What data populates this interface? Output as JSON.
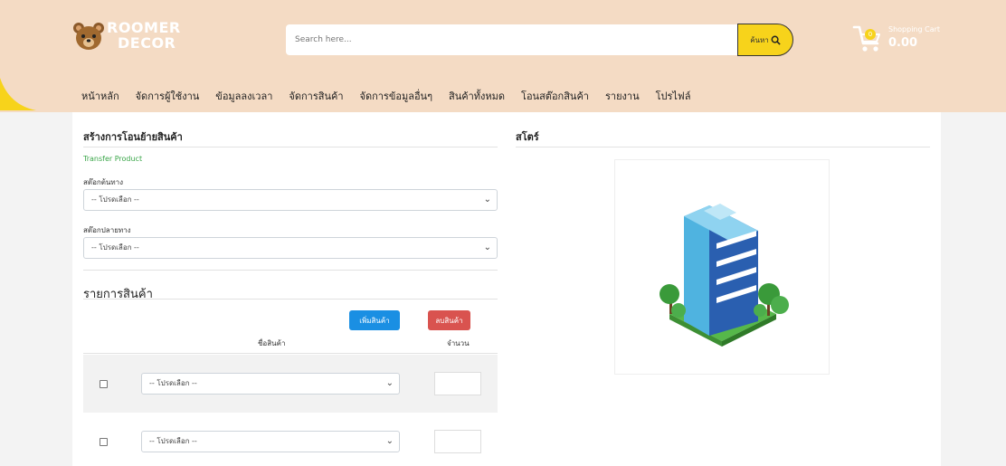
{
  "header": {
    "logo_line1": "ROOMER",
    "logo_line2": "DECOR",
    "search_placeholder": "Search here...",
    "search_button": "ค้นหา",
    "cart_count": "0",
    "cart_label": "Shopping Cart",
    "cart_total": "0.00"
  },
  "nav": [
    "หน้าหลัก",
    "จัดการผู้ใช้งาน",
    "ข้อมูลลงเวลา",
    "จัดการสินค้า",
    "จัดการข้อมูลอื่นๆ",
    "สินค้าทั้งหมด",
    "โอนสต๊อกสินค้า",
    "รายงาน",
    "โปรไฟล์"
  ],
  "form": {
    "title": "สร้างการโอนย้ายสินค้า",
    "subtitle": "Transfer Product",
    "source_label": "สต๊อกต้นทาง",
    "dest_label": "สต๊อกปลายทาง",
    "select_placeholder": "-- โปรดเลือก --"
  },
  "products": {
    "title": "รายการสินค้า",
    "add_button": "เพิ่มสินค้า",
    "delete_button": "ลบสินค้า",
    "col_name": "ชื่อสินค้า",
    "col_qty": "จำนวน",
    "rows": [
      {
        "select": "-- โปรดเลือก --"
      },
      {
        "select": "-- โปรดเลือก --"
      }
    ]
  },
  "store": {
    "title": "สโตร์"
  },
  "colors": {
    "header_bg": "#f4dbc4",
    "accent_yellow": "#f7d31b",
    "add_blue": "#1a8fe3",
    "delete_red": "#d9534f",
    "label_green": "#3aa649"
  }
}
